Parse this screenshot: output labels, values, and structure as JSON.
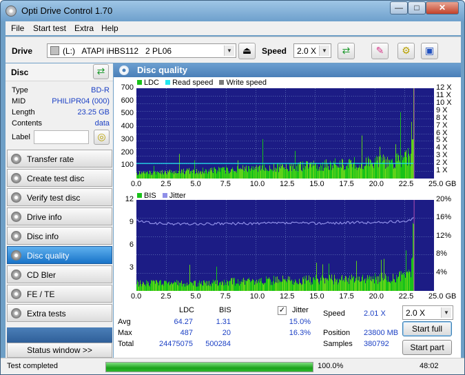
{
  "window": {
    "title": "Opti Drive Control 1.70",
    "minimize": "—",
    "maximize": "□",
    "close": "✕"
  },
  "menu": [
    "File",
    "Start test",
    "Extra",
    "Help"
  ],
  "toolbar": {
    "drive_label": "Drive",
    "drive_value": "(L:)   ATAPI iHBS112   2 PL06",
    "speed_label": "Speed",
    "speed_value": "2.0 X"
  },
  "disc": {
    "title": "Disc",
    "rows": [
      {
        "key": "Type",
        "value": "BD-R"
      },
      {
        "key": "MID",
        "value": "PHILIPR04 (000)"
      },
      {
        "key": "Length",
        "value": "23.25 GB"
      },
      {
        "key": "Contents",
        "value": "data"
      },
      {
        "key": "Label",
        "value": ""
      }
    ]
  },
  "nav": [
    {
      "label": "Transfer rate",
      "active": false
    },
    {
      "label": "Create test disc",
      "active": false
    },
    {
      "label": "Verify test disc",
      "active": false
    },
    {
      "label": "Drive info",
      "active": false
    },
    {
      "label": "Disc info",
      "active": false
    },
    {
      "label": "Disc quality",
      "active": true
    },
    {
      "label": "CD Bler",
      "active": false
    },
    {
      "label": "FE / TE",
      "active": false
    },
    {
      "label": "Extra tests",
      "active": false
    }
  ],
  "status_window_button": "Status window >>",
  "panel_title": "Disc quality",
  "colors": {
    "ldc": "#19c219",
    "read_speed": "#21e7ef",
    "write_speed": "#7a7a7a",
    "bis": "#19c219",
    "jitter": "#8f8fe8",
    "chart_bg": "#1c1c85",
    "grid": "#5566b0"
  },
  "chart_data": [
    {
      "type": "area",
      "legend": [
        "LDC",
        "Read speed",
        "Write speed"
      ],
      "x_ticks": [
        "0.0",
        "2.5",
        "5.0",
        "7.5",
        "10.0",
        "12.5",
        "15.0",
        "17.5",
        "20.0",
        "22.5",
        "25.0 GB"
      ],
      "y_ticks": [
        "700",
        "600",
        "500",
        "400",
        "300",
        "200",
        "100"
      ],
      "y2_ticks": [
        "12 X",
        "11 X",
        "10 X",
        "9 X",
        "8 X",
        "7 X",
        "6 X",
        "5 X",
        "4 X",
        "3 X",
        "2 X",
        "1 X"
      ],
      "xlim": [
        0,
        25
      ],
      "ylim": [
        0,
        700
      ],
      "y2lim": [
        0,
        12
      ],
      "series": [
        {
          "name": "LDC",
          "x": [
            0,
            1,
            2,
            3,
            4,
            5,
            6,
            7,
            8,
            9,
            10,
            11,
            12,
            13,
            14,
            15,
            16,
            17,
            18,
            19,
            20,
            21,
            22,
            23,
            23.3
          ],
          "values": [
            40,
            45,
            50,
            55,
            55,
            60,
            62,
            65,
            70,
            72,
            75,
            78,
            85,
            88,
            95,
            100,
            105,
            110,
            115,
            118,
            125,
            130,
            140,
            170,
            320
          ]
        },
        {
          "name": "Read speed",
          "x": [
            0,
            23.3
          ],
          "values": [
            2.01,
            2.01
          ]
        }
      ]
    },
    {
      "type": "area",
      "legend": [
        "BIS",
        "Jitter"
      ],
      "x_ticks": [
        "0.0",
        "2.5",
        "5.0",
        "7.5",
        "10.0",
        "12.5",
        "15.0",
        "17.5",
        "20.0",
        "22.5",
        "25.0 GB"
      ],
      "y_ticks": [
        "12",
        "9",
        "6",
        "3"
      ],
      "y2_ticks": [
        "20%",
        "16%",
        "12%",
        "8%",
        "4%"
      ],
      "xlim": [
        0,
        25
      ],
      "ylim": [
        0,
        12
      ],
      "y2lim": [
        0,
        20
      ],
      "series": [
        {
          "name": "BIS",
          "x": [
            0,
            2,
            4,
            6,
            8,
            10,
            12,
            14,
            16,
            18,
            20,
            22,
            23,
            23.3
          ],
          "values": [
            1,
            1,
            1,
            1,
            1.2,
            1.3,
            1.4,
            1.4,
            1.5,
            1.5,
            1.6,
            1.8,
            2.5,
            9
          ]
        },
        {
          "name": "Jitter",
          "x": [
            0,
            0.5,
            1,
            2,
            4,
            6,
            8,
            10,
            12,
            14,
            16,
            18,
            20,
            22,
            23,
            23.3
          ],
          "values": [
            15.5,
            15.2,
            15.0,
            14.8,
            14.7,
            14.7,
            14.8,
            14.8,
            14.9,
            14.9,
            14.9,
            15.0,
            15.0,
            15.2,
            15.6,
            16.3
          ]
        }
      ]
    }
  ],
  "stats": {
    "col_ldc": "LDC",
    "col_bis": "BIS",
    "col_jitter": "Jitter",
    "avg_label": "Avg",
    "max_label": "Max",
    "total_label": "Total",
    "avg_ldc": "64.27",
    "avg_bis": "1.31",
    "avg_jitter": "15.0%",
    "max_ldc": "487",
    "max_bis": "20",
    "max_jitter": "16.3%",
    "total_ldc": "24475075",
    "total_bis": "500284",
    "jitter_checked": "✓",
    "speed_label": "Speed",
    "speed_value": "2.01 X",
    "position_label": "Position",
    "position_value": "23800 MB",
    "samples_label": "Samples",
    "samples_value": "380792",
    "speed_select": "2.0 X",
    "start_full": "Start full",
    "start_part": "Start part"
  },
  "status": {
    "text": "Test completed",
    "progress_text": "100.0%",
    "progress_fraction": 1.0,
    "time": "48:02"
  }
}
